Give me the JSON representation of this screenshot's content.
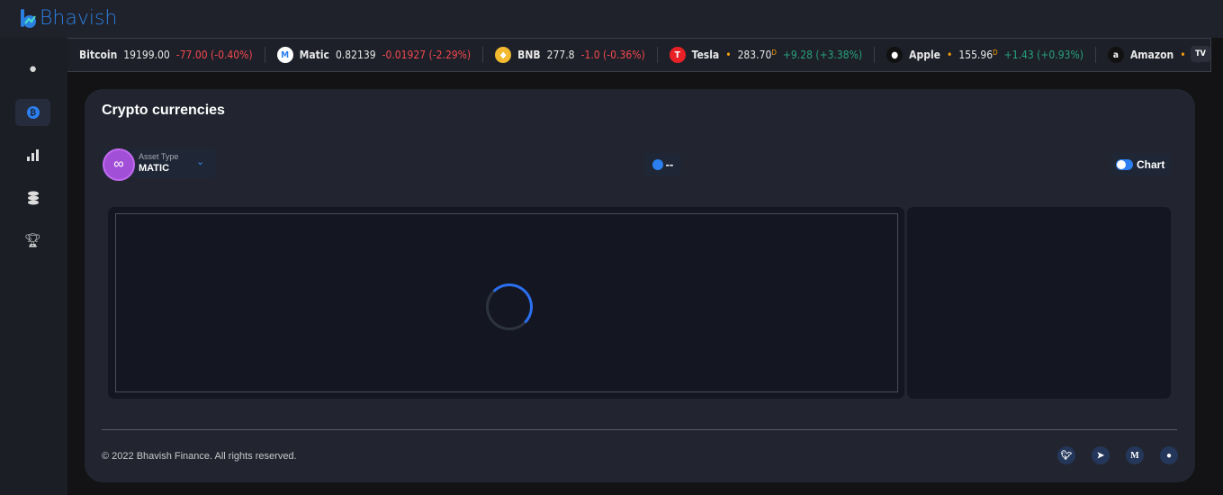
{
  "app": {
    "name": "Bhavish"
  },
  "sidebar": {
    "items": [
      {
        "icon": "user-icon"
      },
      {
        "icon": "bitcoin-icon",
        "active": true
      },
      {
        "icon": "bar-chart-icon"
      },
      {
        "icon": "coins-icon"
      },
      {
        "icon": "trophy-icon"
      }
    ]
  },
  "ticker": {
    "items": [
      {
        "name": "Bitcoin",
        "price": "19199.00",
        "change": "-77.00 (-0.40%)",
        "trend": "negative"
      },
      {
        "name": "Matic",
        "price": "0.82139",
        "change": "-0.01927 (-2.29%)",
        "trend": "negative"
      },
      {
        "name": "BNB",
        "price": "277.8",
        "change": "-1.0 (-0.36%)",
        "trend": "negative"
      },
      {
        "name": "Tesla",
        "price": "283.70",
        "marker": "D",
        "change": "+9.28 (+3.38%)",
        "trend": "positive"
      },
      {
        "name": "Apple",
        "price": "155.96",
        "marker": "D",
        "change": "+1.43 (+0.93%)",
        "trend": "positive"
      },
      {
        "name": "Amazon"
      }
    ],
    "badge": "TV"
  },
  "main": {
    "title": "Crypto currencies",
    "asset_type_label": "Asset Type",
    "asset_type_value": "MATIC",
    "timer_value": "--",
    "chart_toggle_label": "Chart",
    "chart_toggle_on": true
  },
  "footer": {
    "copyright": "© 2022 Bhavish Finance. All rights reserved.",
    "social": [
      "twitter-icon",
      "telegram-icon",
      "medium-icon",
      "github-icon"
    ],
    "medium_letter": "M"
  },
  "colors": {
    "accent": "#2b7ff0",
    "negative": "#f2494f",
    "positive": "#26a17b",
    "matic": "#a24fd8"
  }
}
